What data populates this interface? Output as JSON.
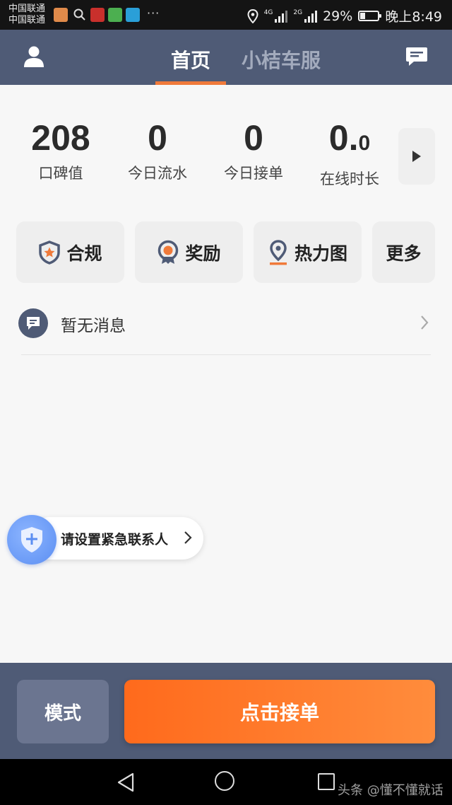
{
  "status_bar": {
    "carrier_1": "中国联通",
    "carrier_2": "中国联通",
    "more": "···",
    "network_1": "4G",
    "network_2": "2G",
    "battery": "29%",
    "battery_level": 0.29,
    "time": "晚上8:49"
  },
  "header": {
    "tabs": [
      {
        "label": "首页",
        "active": true
      },
      {
        "label": "小桔车服",
        "active": false
      }
    ],
    "profile_icon": "person-icon",
    "message_icon": "chat-icon",
    "bg_color": "#4f5b76",
    "accent_color": "#f07a3a"
  },
  "stats": [
    {
      "value": "208",
      "label": "口碑值"
    },
    {
      "value": "0",
      "label": "今日流水"
    },
    {
      "value": "0",
      "label": "今日接单"
    },
    {
      "value_main": "0.",
      "value_small": "0",
      "label": "在线时长"
    }
  ],
  "quick_actions": [
    {
      "label": "合规",
      "icon": "badge-shield-icon"
    },
    {
      "label": "奖励",
      "icon": "medal-icon"
    },
    {
      "label": "热力图",
      "icon": "map-pin-icon"
    },
    {
      "label": "更多",
      "icon": ""
    }
  ],
  "message": {
    "text": "暂无消息",
    "icon": "chat-bubble-icon"
  },
  "emergency": {
    "text": "请设置紧急联系人",
    "icon": "shield-plus-icon"
  },
  "bottom": {
    "mode_label": "模式",
    "go_label": "点击接单"
  },
  "watermark": "头条 @懂不懂就话"
}
